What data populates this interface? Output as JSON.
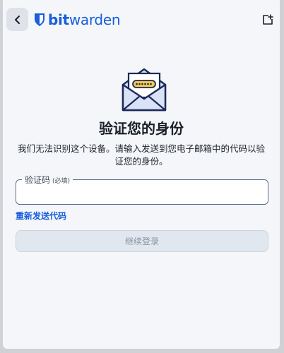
{
  "header": {
    "back_icon": "chevron-left-icon",
    "logo_icon": "bitwarden-shield-icon",
    "brand_bold": "bit",
    "brand_light": "warden",
    "popout_icon": "popout-icon"
  },
  "illustration": {
    "icon": "envelope-code-icon",
    "code_mask": "••••••"
  },
  "main": {
    "title": "验证您的身份",
    "description": "我们无法识别这个设备。请输入发送到您电子邮箱中的代码以验证您的身份。",
    "code_field": {
      "label": "验证码",
      "required": "(必填)",
      "value": ""
    },
    "resend_link": "重新发送代码",
    "continue_button": "继续登录"
  },
  "colors": {
    "brand": "#175ddc",
    "background": "#f4f6f9",
    "text": "#1b2029",
    "button_disabled_bg": "#e1e7ee"
  }
}
